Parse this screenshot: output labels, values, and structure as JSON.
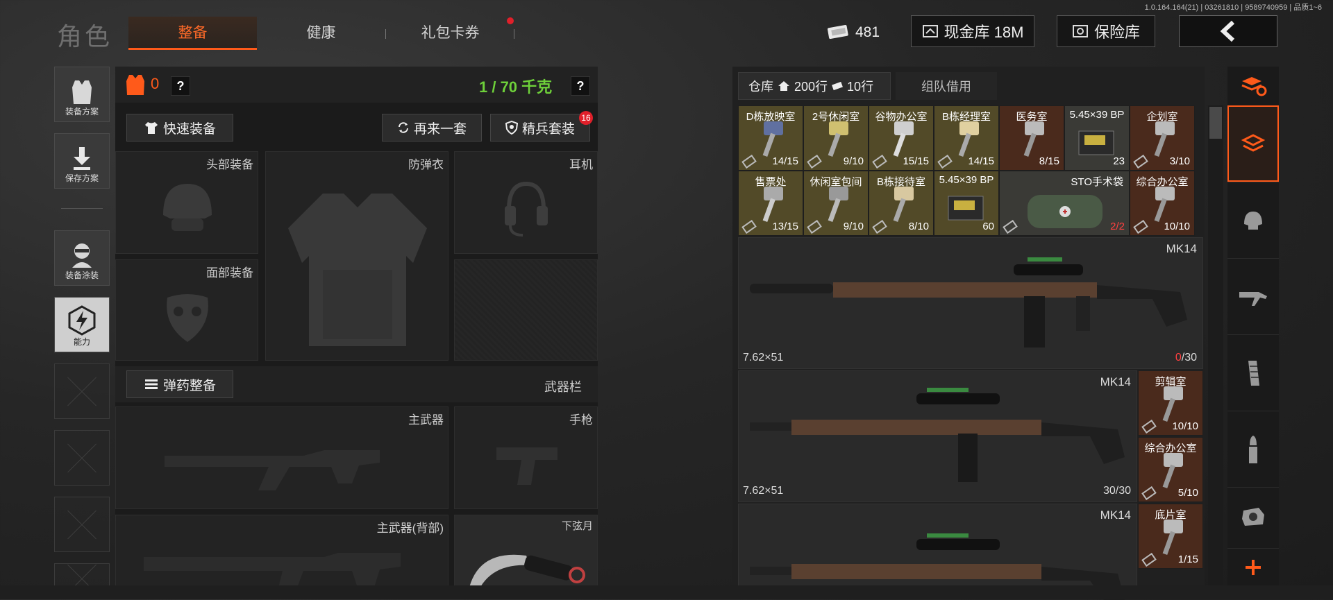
{
  "version_text": "1.0.164.164(21) | 03261810 | 9589740959 | 品质1~6",
  "header": {
    "title": "角色",
    "tabs": [
      {
        "label": "整备",
        "active": true
      },
      {
        "label": "健康",
        "active": false
      },
      {
        "label": "礼包卡券",
        "active": false,
        "badge": true
      }
    ],
    "currency_value": "481",
    "cash_vault_label": "现金库 18M",
    "safe_label": "保险库"
  },
  "sidebar": {
    "items": [
      {
        "label": "装备方案",
        "icon": "vest-icon"
      },
      {
        "label": "保存方案",
        "icon": "download-icon"
      },
      {
        "label": "装备涂装",
        "icon": "operator-icon"
      },
      {
        "label": "能力",
        "icon": "lightning-hex-icon",
        "active": true
      }
    ]
  },
  "equipment": {
    "armor_count": "0",
    "weight": "1 / 70 千克",
    "quick_equip": "快速装备",
    "again": "再来一套",
    "elite": "精兵套装",
    "elite_badge": "16",
    "slots": {
      "head": "头部装备",
      "armor": "防弹衣",
      "ear": "耳机",
      "face": "面部装备"
    },
    "ammo_equip": "弹药整备",
    "weapon_bar": "武器栏",
    "primary": "主武器",
    "pistol": "手枪",
    "primary_back": "主武器(背部)",
    "melee": "下弦月"
  },
  "warehouse": {
    "tab_label": "仓库",
    "rows_a": "200行",
    "rows_b": "10行",
    "team_borrow": "组队借用",
    "row1": [
      {
        "name": "D栋放映室",
        "count": "14/15",
        "color": "yellow"
      },
      {
        "name": "2号休闲室",
        "count": "9/10",
        "color": "yellow"
      },
      {
        "name": "谷物办公室",
        "count": "15/15",
        "color": "yellow"
      },
      {
        "name": "B栋经理室",
        "count": "14/15",
        "color": "yellow"
      },
      {
        "name": "医务室",
        "count": "8/15",
        "color": "brown"
      },
      {
        "name": "5.45×39 BP",
        "count": "23",
        "color": "dark"
      },
      {
        "name": "企划室",
        "count": "3/10",
        "color": "brown"
      }
    ],
    "row2": [
      {
        "name": "售票处",
        "count": "13/15",
        "color": "yellow"
      },
      {
        "name": "休闲室包间",
        "count": "9/10",
        "color": "yellow"
      },
      {
        "name": "B栋接待室",
        "count": "8/10",
        "color": "yellow"
      },
      {
        "name": "5.45×39 BP",
        "count": "60",
        "color": "yellow"
      },
      {
        "name": "综合办公室",
        "count": "10/10",
        "color": "brown"
      }
    ],
    "sto_bag": {
      "name": "STO手术袋",
      "count": "2/2"
    },
    "guns": [
      {
        "name": "MK14",
        "caliber": "7.62×51",
        "ammo_cur": "0",
        "ammo_max": "/30"
      },
      {
        "name": "MK14",
        "caliber": "7.62×51",
        "ammo": "30/30"
      },
      {
        "name": "MK14"
      }
    ],
    "side_keys": [
      {
        "name": "剪辑室",
        "count": "10/10"
      },
      {
        "name": "综合办公室",
        "count": "5/10"
      },
      {
        "name": "底片室",
        "count": "1/15"
      }
    ]
  },
  "colors": {
    "accent": "#ff5a1a",
    "green": "#6ed03a",
    "red": "#e0202a"
  }
}
